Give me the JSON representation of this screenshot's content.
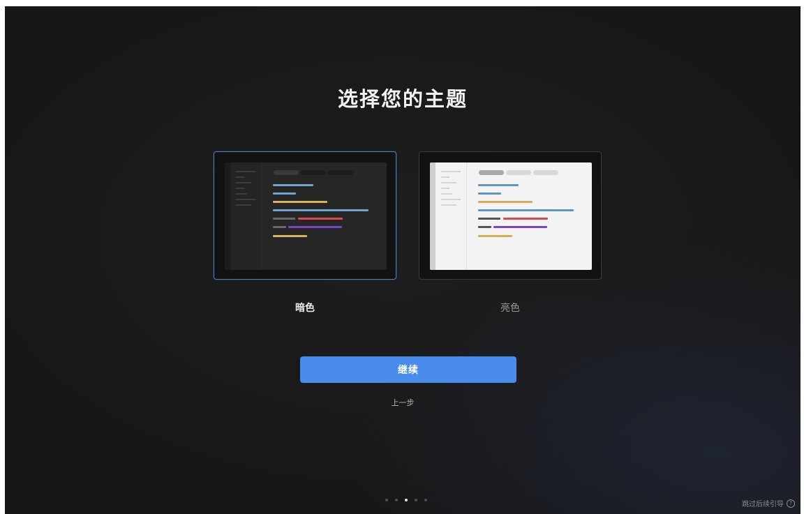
{
  "page": {
    "title": "选择您的主题"
  },
  "themes": [
    {
      "id": "dark",
      "label": "暗色",
      "selected": true
    },
    {
      "id": "light",
      "label": "亮色",
      "selected": false
    }
  ],
  "actions": {
    "continue_label": "继续",
    "back_label": "上一步"
  },
  "steps": {
    "total": 5,
    "current": 3
  },
  "footer": {
    "skip_label": "跳过后续引导",
    "help_icon": "question-circle-icon"
  },
  "colors": {
    "accent": "#4a8cec",
    "background": "#161616",
    "selected_border": "#4d7fc9",
    "syntax_blue": "#6ea4cf",
    "syntax_yellow": "#d9b25f",
    "syntax_red": "#d94a4a",
    "syntax_purple": "#7a44c7",
    "syntax_gray": "#555555"
  }
}
